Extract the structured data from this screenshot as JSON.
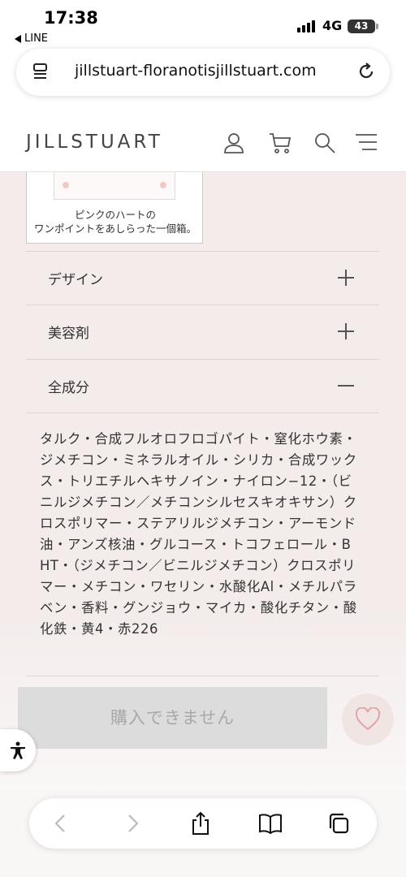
{
  "status_bar": {
    "time": "17:38",
    "back_app": "LINE",
    "network": "4G",
    "battery": "43"
  },
  "browser": {
    "url": "jillstuart-floranotisjillstuart.com"
  },
  "site": {
    "logo": "JILLSTUART",
    "icons": [
      "user-icon",
      "cart-icon",
      "search-icon",
      "menu-icon"
    ]
  },
  "product": {
    "image_caption": "ピンクのハートの\nワンポイントをあしらった一個箱。",
    "accordion": [
      {
        "label": "デザイン",
        "state": "+"
      },
      {
        "label": "美容剤",
        "state": "+"
      },
      {
        "label": "全成分",
        "state": "−"
      }
    ],
    "ingredients": "タルク・合成フルオロフロゴパイト・窒化ホウ素・ジメチコン・ミネラルオイル・シリカ・合成ワックス・トリエチルヘキサノイン・ナイロン−12・（ビニルジメチコン／メチコンシルセスキオキサン）クロスポリマー・ステアリルジメチコン・アーモンド油・アンズ核油・グルコース・トコフェロール・BHT・（ジメチコン／ビニルジメチコン）クロスポリマー・メチコン・ワセリン・水酸化Al・メチルパラベン・香料・グンジョウ・マイカ・酸化チタン・酸化鉄・黄4・赤226",
    "buy_button": "購入できません"
  },
  "colors": {
    "content_bg": "#f3eceb",
    "button_disabled": "#dcdcdc",
    "heart": "#e2a3a3"
  }
}
